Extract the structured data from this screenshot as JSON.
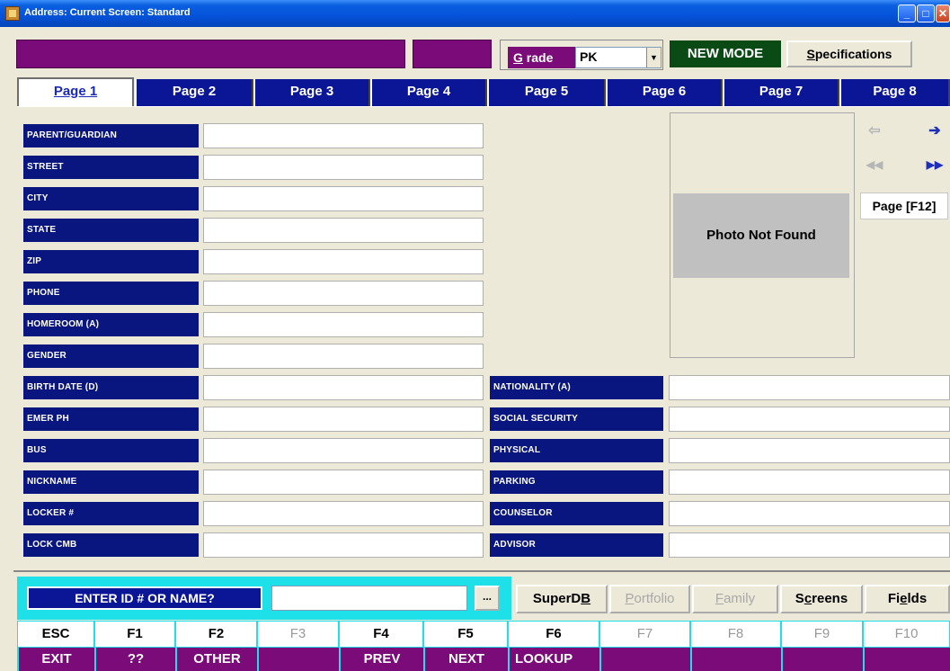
{
  "window": {
    "title": "Address: Current Screen: Standard"
  },
  "header": {
    "grade_label_prefix": "G",
    "grade_label_rest": " rade",
    "grade_value": "PK",
    "mode_badge": "NEW MODE",
    "specifications_prefix": "S",
    "specifications_rest": "pecifications"
  },
  "tabs": [
    {
      "label": "Page 1",
      "active": true
    },
    {
      "label": "Page 2"
    },
    {
      "label": "Page 3"
    },
    {
      "label": "Page 4"
    },
    {
      "label": "Page 5"
    },
    {
      "label": "Page 6"
    },
    {
      "label": "Page 7"
    },
    {
      "label": "Page 8"
    }
  ],
  "fields_left": [
    {
      "label": "PARENT/GUARDIAN",
      "value": ""
    },
    {
      "label": "STREET",
      "value": ""
    },
    {
      "label": "CITY",
      "value": ""
    },
    {
      "label": "STATE",
      "value": ""
    },
    {
      "label": "ZIP",
      "value": ""
    },
    {
      "label": "PHONE",
      "value": ""
    },
    {
      "label": "HOMEROOM (A)",
      "value": ""
    },
    {
      "label": "GENDER",
      "value": ""
    },
    {
      "label": "BIRTH DATE (D)",
      "value": ""
    },
    {
      "label": "EMER PH",
      "value": ""
    },
    {
      "label": "BUS",
      "value": ""
    },
    {
      "label": "NICKNAME",
      "value": ""
    },
    {
      "label": "LOCKER #",
      "value": ""
    },
    {
      "label": "LOCK CMB",
      "value": ""
    }
  ],
  "fields_right": [
    {
      "label": "NATIONALITY (A)",
      "value": ""
    },
    {
      "label": "SOCIAL SECURITY",
      "value": ""
    },
    {
      "label": "PHYSICAL",
      "value": ""
    },
    {
      "label": "PARKING",
      "value": ""
    },
    {
      "label": "COUNSELOR",
      "value": ""
    },
    {
      "label": "ADVISOR",
      "value": ""
    }
  ],
  "photo": {
    "text": "Photo Not Found"
  },
  "record_nav": {
    "prev_icon": "arrow-left-icon",
    "next_icon": "arrow-right-icon",
    "first_icon": "double-arrow-left-icon",
    "last_icon": "double-arrow-right-icon",
    "page_button": "Page [F12]"
  },
  "search": {
    "label": "ENTER ID # OR NAME?",
    "value": "",
    "browse": "..."
  },
  "actions": {
    "superdb_a": "SuperD",
    "superdb_u": "B",
    "superdb_b": "",
    "portfolio_a": "",
    "portfolio_u": "P",
    "portfolio_b": "ortfolio",
    "family_a": "",
    "family_u": "F",
    "family_b": "amily",
    "screens_a": "S",
    "screens_u": "c",
    "screens_b": "reens",
    "fields_a": "Fi",
    "fields_u": "e",
    "fields_b": "lds"
  },
  "function_keys": [
    {
      "key": "ESC",
      "action": "EXIT",
      "enabled": true
    },
    {
      "key": "F1",
      "action": "??",
      "enabled": true
    },
    {
      "key": "F2",
      "action": "OTHER",
      "enabled": true
    },
    {
      "key": "F3",
      "action": "",
      "enabled": false
    },
    {
      "key": "F4",
      "action": "PREV",
      "enabled": true
    },
    {
      "key": "F5",
      "action": "NEXT",
      "enabled": true
    },
    {
      "key": "F6",
      "action": "LOOKUP",
      "enabled": true
    },
    {
      "key": "F7",
      "action": "",
      "enabled": false
    },
    {
      "key": "F8",
      "action": "",
      "enabled": false
    },
    {
      "key": "F9",
      "action": "",
      "enabled": false
    },
    {
      "key": "F10",
      "action": "",
      "enabled": false
    }
  ],
  "colors": {
    "label_bg": "#0a1680",
    "tab_bg": "#0a1696",
    "purple": "#7a0b79",
    "cyan": "#1ee0e8",
    "new_mode_bg": "#0a4a14"
  }
}
